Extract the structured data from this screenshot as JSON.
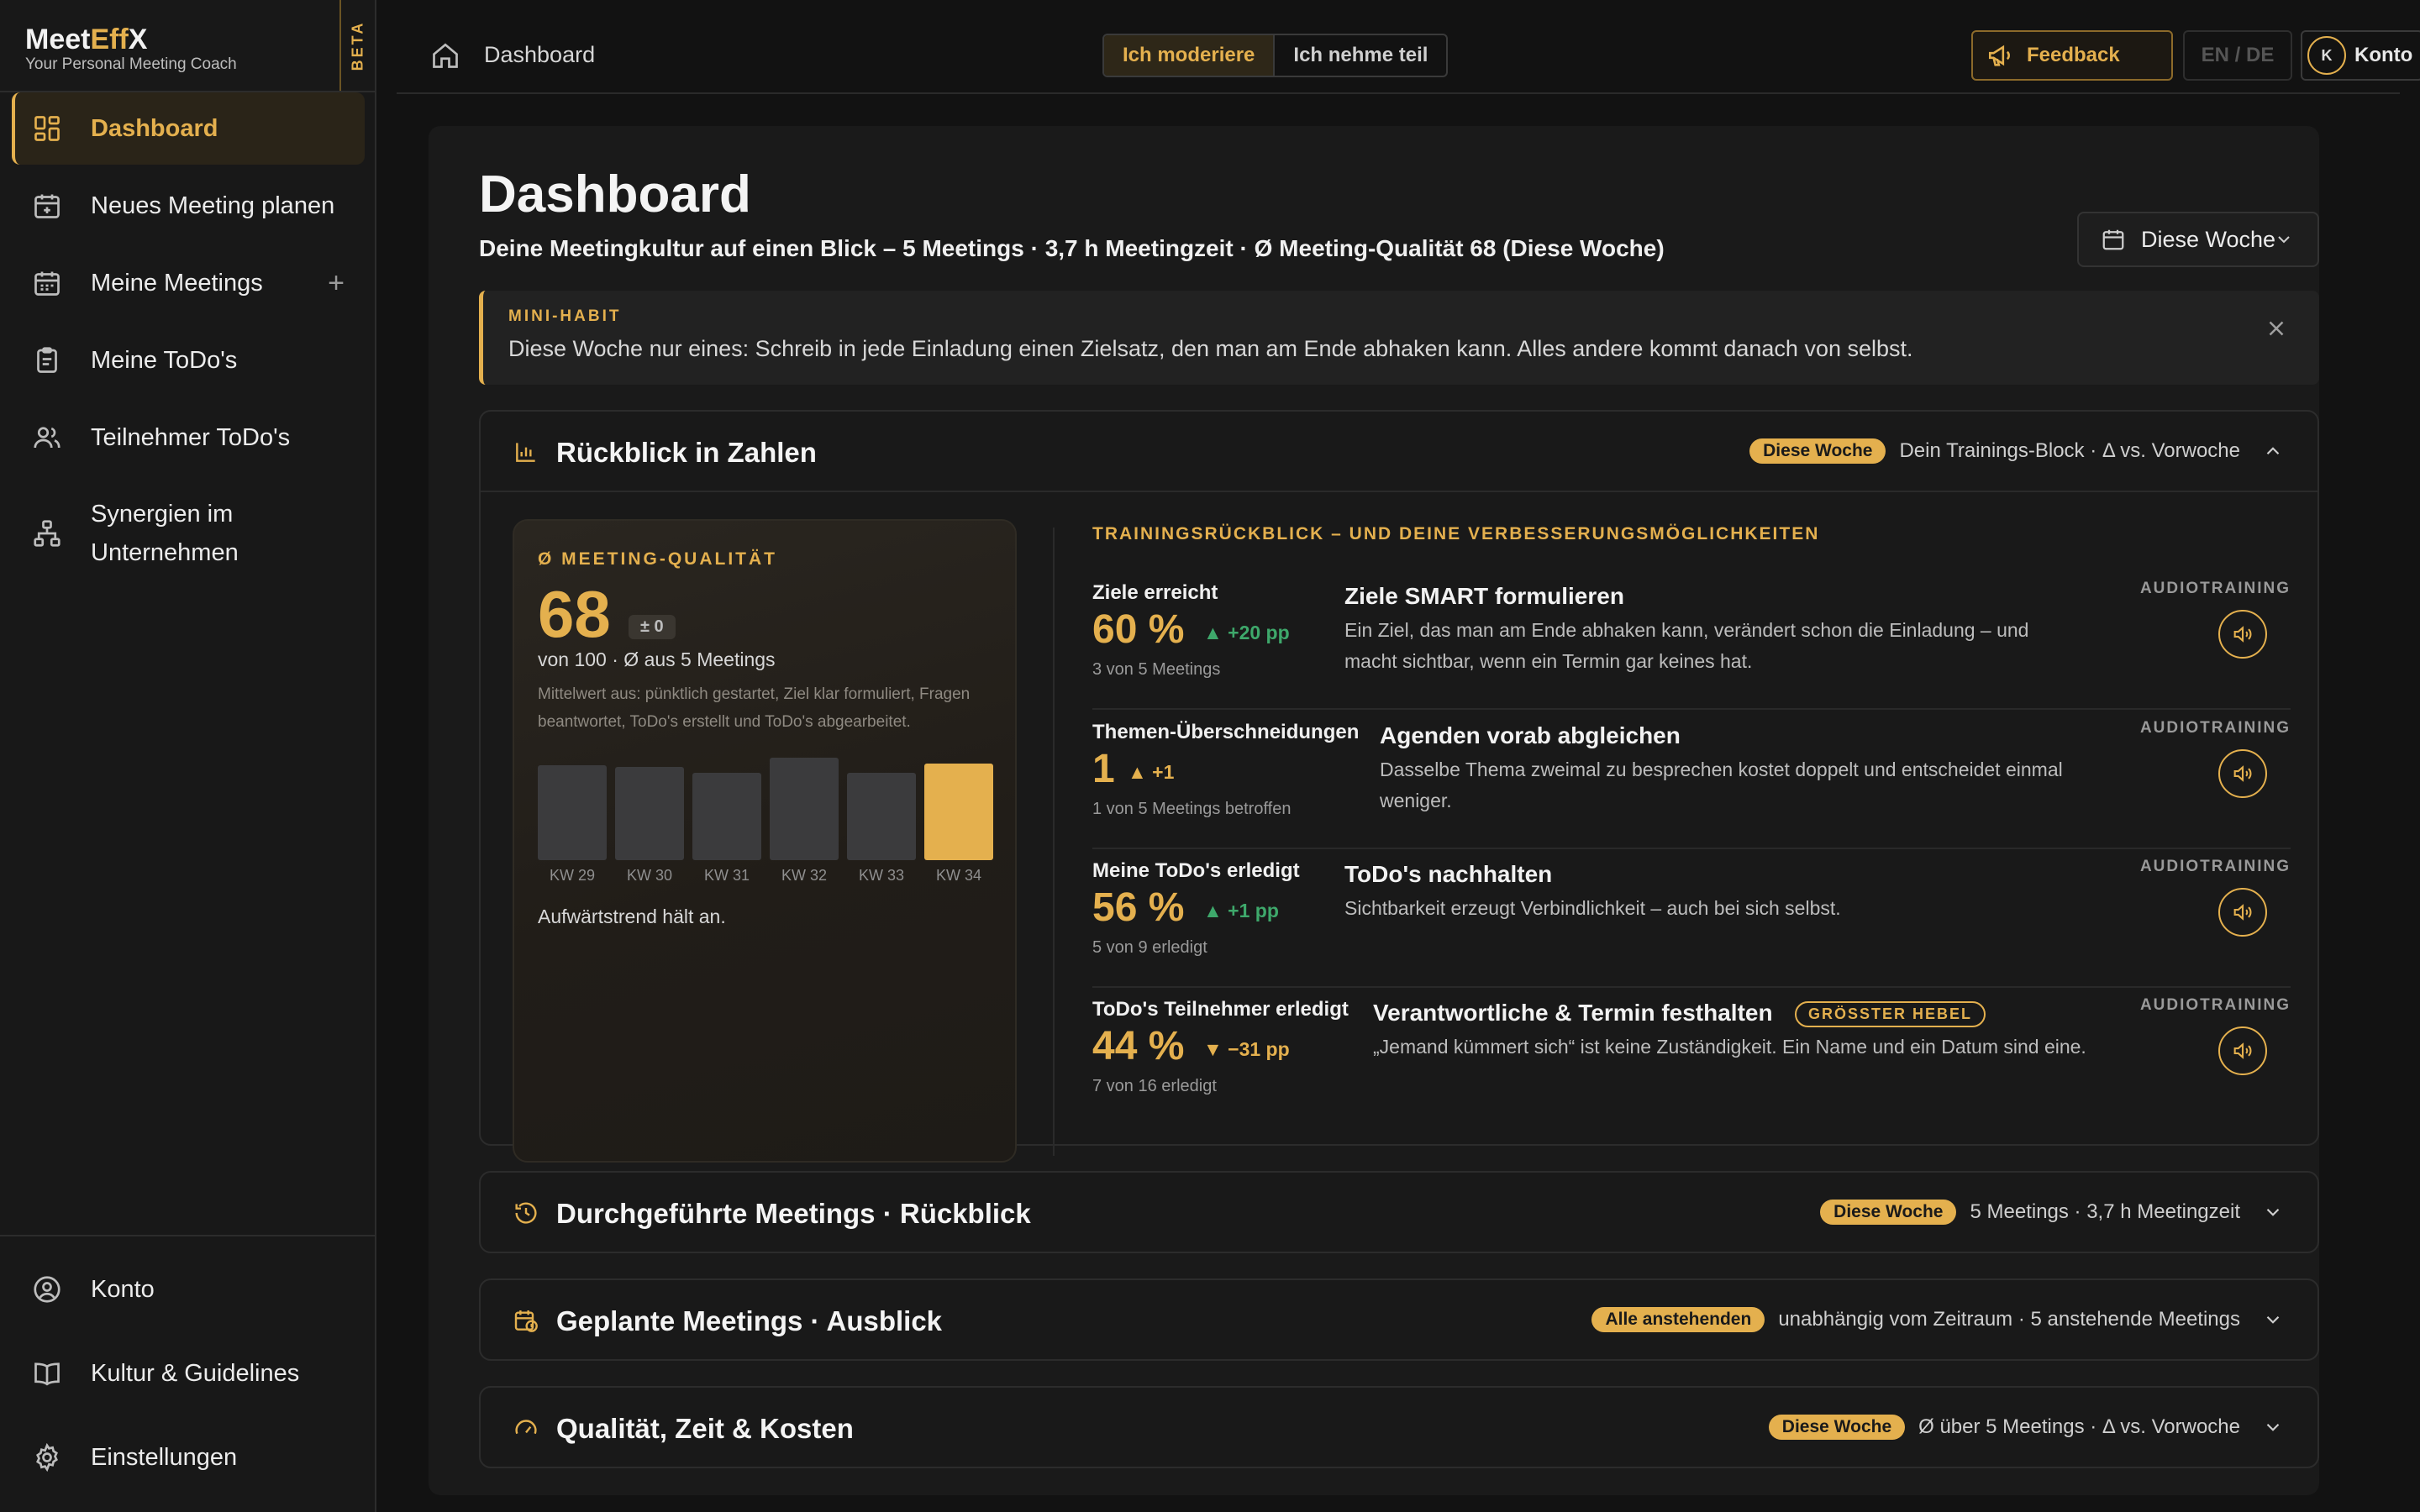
{
  "brand": {
    "logo_meet": "Meet",
    "logo_eff": "Eff",
    "logo_x": "X",
    "tagline": "Your Personal Meeting Coach",
    "beta": "BETA"
  },
  "nav": {
    "dashboard": "Dashboard",
    "new_meeting": "Neues Meeting planen",
    "my_meetings": "Meine Meetings",
    "my_todos": "Meine ToDo's",
    "participant_todos": "Teilnehmer ToDo's",
    "synergies_1": "Synergien im",
    "synergies_2": "Unternehmen",
    "account": "Konto",
    "culture": "Kultur & Guidelines",
    "settings": "Einstellungen"
  },
  "topbar": {
    "breadcrumb": "Dashboard",
    "role_moderate": "Ich moderiere",
    "role_participate": "Ich nehme teil",
    "feedback": "Feedback",
    "lang": "EN / DE",
    "avatar_initial": "K",
    "account": "Konto"
  },
  "header": {
    "title": "Dashboard",
    "subtitle": "Deine Meetingkultur auf einen Blick – 5 Meetings · 3,7 h Meetingzeit · Ø Meeting-Qualität 68 (Diese Woche)",
    "period": "Diese Woche"
  },
  "habit": {
    "label": "MINI-HABIT",
    "text": "Diese Woche nur eines: Schreib in jede Einladung einen Zielsatz, den man am Ende abhaken kann. Alles andere kommt danach von selbst."
  },
  "review": {
    "title": "Rückblick in Zahlen",
    "pill": "Diese Woche",
    "meta": "Dein Trainings-Block · Δ vs. Vorwoche",
    "quality": {
      "label": "Ø MEETING-QUALITÄT",
      "value": "68",
      "delta": "± 0",
      "sub": "von 100 · Ø aus 5 Meetings",
      "explain": "Mittelwert aus: pünktlich gestartet, Ziel klar formuliert, Fragen beantwortet, ToDo's erstellt und ToDo's abgearbeitet.",
      "trend": "Aufwärtstrend hält an.",
      "weeks": [
        {
          "label": "KW 29",
          "value": 61,
          "current": false
        },
        {
          "label": "KW 30",
          "value": 60,
          "current": false
        },
        {
          "label": "KW 31",
          "value": 56,
          "current": false
        },
        {
          "label": "KW 32",
          "value": 66,
          "current": false
        },
        {
          "label": "KW 33",
          "value": 56,
          "current": false
        },
        {
          "label": "KW 34",
          "value": 62,
          "current": true
        }
      ]
    },
    "training_header": "TRAININGSRÜCKBLICK – UND DEINE VERBESSERUNGSMÖGLICHKEITEN",
    "audio_label": "AUDIOTRAINING",
    "rows": [
      {
        "metric": "Ziele erreicht",
        "value": "60 %",
        "delta": "▲ +20 pp",
        "sub": "3 von 5 Meetings",
        "title": "Ziele SMART formulieren",
        "text": "Ein Ziel, das man am Ende abhaken kann, verändert schon die Einladung – und macht sichtbar, wenn ein Termin gar keines hat."
      },
      {
        "metric": "Themen-Überschneidungen",
        "value": "1",
        "delta": "▲ +1",
        "sub": "1 von 5 Meetings betroffen",
        "title": "Agenden vorab abgleichen",
        "text": "Dasselbe Thema zweimal zu besprechen kostet doppelt und entscheidet einmal weniger."
      },
      {
        "metric": "Meine ToDo's erledigt",
        "value": "56 %",
        "delta": "▲ +1 pp",
        "sub": "5 von 9 erledigt",
        "title": "ToDo's nachhalten",
        "text": "Sichtbarkeit erzeugt Verbindlichkeit – auch bei sich selbst."
      },
      {
        "metric": "ToDo's Teilnehmer erledigt",
        "value": "44 %",
        "delta": "▼ −31 pp",
        "sub": "7 von 16 erledigt",
        "title": "Verantwortliche & Termin festhalten",
        "badge": "GRÖSSTER HEBEL",
        "text": "„Jemand kümmert sich“ ist keine Zuständigkeit. Ein Name und ein Datum sind eine."
      }
    ]
  },
  "past": {
    "title": "Durchgeführte Meetings · Rückblick",
    "pill": "Diese Woche",
    "meta": "5 Meetings · 3,7 h Meetingzeit"
  },
  "planned": {
    "title": "Geplante Meetings · Ausblick",
    "pill": "Alle anstehenden",
    "meta": "unabhängig vom Zeitraum · 5 anstehende Meetings"
  },
  "quality_costs": {
    "title": "Qualität, Zeit & Kosten",
    "pill": "Diese Woche",
    "meta": "Ø über 5 Meetings · Δ vs. Vorwoche"
  }
}
